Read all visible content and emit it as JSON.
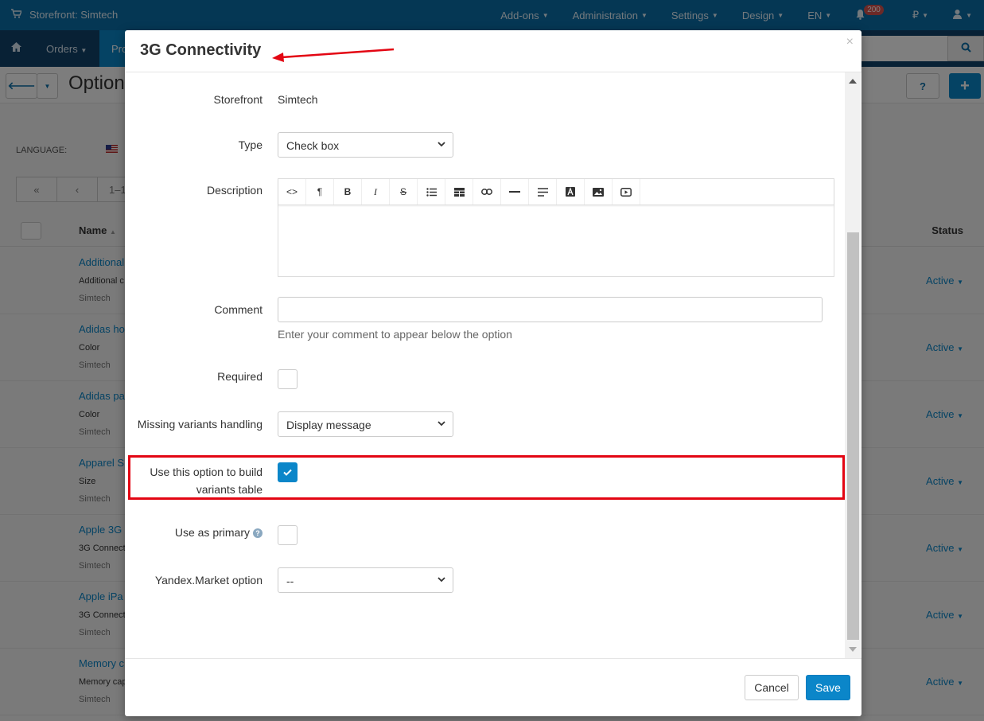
{
  "app": {
    "storefront_label": "Storefront: Simtech"
  },
  "topnav": {
    "addons": "Add-ons",
    "administration": "Administration",
    "settings": "Settings",
    "design": "Design",
    "language": "EN",
    "notifications_count": "200",
    "currency": "₽"
  },
  "subnav": {
    "orders": "Orders",
    "products": "Pro"
  },
  "toolbar": {
    "title": "Option"
  },
  "list": {
    "language_label": "LANGUAGE:",
    "pager_range": "1–1",
    "col_name": "Name",
    "col_status": "Status",
    "rows": [
      {
        "name": "Additional",
        "sub": "Additional c",
        "store": "Simtech",
        "status": "Active"
      },
      {
        "name": "Adidas ho",
        "sub": "Color",
        "store": "Simtech",
        "status": "Active"
      },
      {
        "name": "Adidas pa",
        "sub": "Color",
        "store": "Simtech",
        "status": "Active"
      },
      {
        "name": "Apparel S",
        "sub": "Size",
        "store": "Simtech",
        "status": "Active"
      },
      {
        "name": "Apple 3G",
        "sub": "3G Connect",
        "store": "Simtech",
        "status": "Active"
      },
      {
        "name": "Apple iPa",
        "sub": "3G Connect",
        "store": "Simtech",
        "status": "Active"
      },
      {
        "name": "Memory c",
        "sub": "Memory cap",
        "store": "Simtech",
        "status": "Active"
      }
    ]
  },
  "modal": {
    "title": "3G Connectivity",
    "storefront_label": "Storefront",
    "storefront_value": "Simtech",
    "type_label": "Type",
    "type_value": "Check box",
    "description_label": "Description",
    "comment_label": "Comment",
    "comment_value": "",
    "comment_hint": "Enter your comment to appear below the option",
    "required_label": "Required",
    "required_checked": false,
    "missing_label": "Missing variants handling",
    "missing_value": "Display message",
    "variants_label_line1": "Use this option to build",
    "variants_label_line2": "variants table",
    "variants_checked": true,
    "primary_label": "Use as primary",
    "primary_checked": false,
    "yandex_label": "Yandex.Market option",
    "yandex_value": "--",
    "cancel": "Cancel",
    "save": "Save"
  },
  "colors": {
    "accent": "#0b86c9",
    "highlight": "#e30613",
    "topbar": "#0a6ea8"
  }
}
